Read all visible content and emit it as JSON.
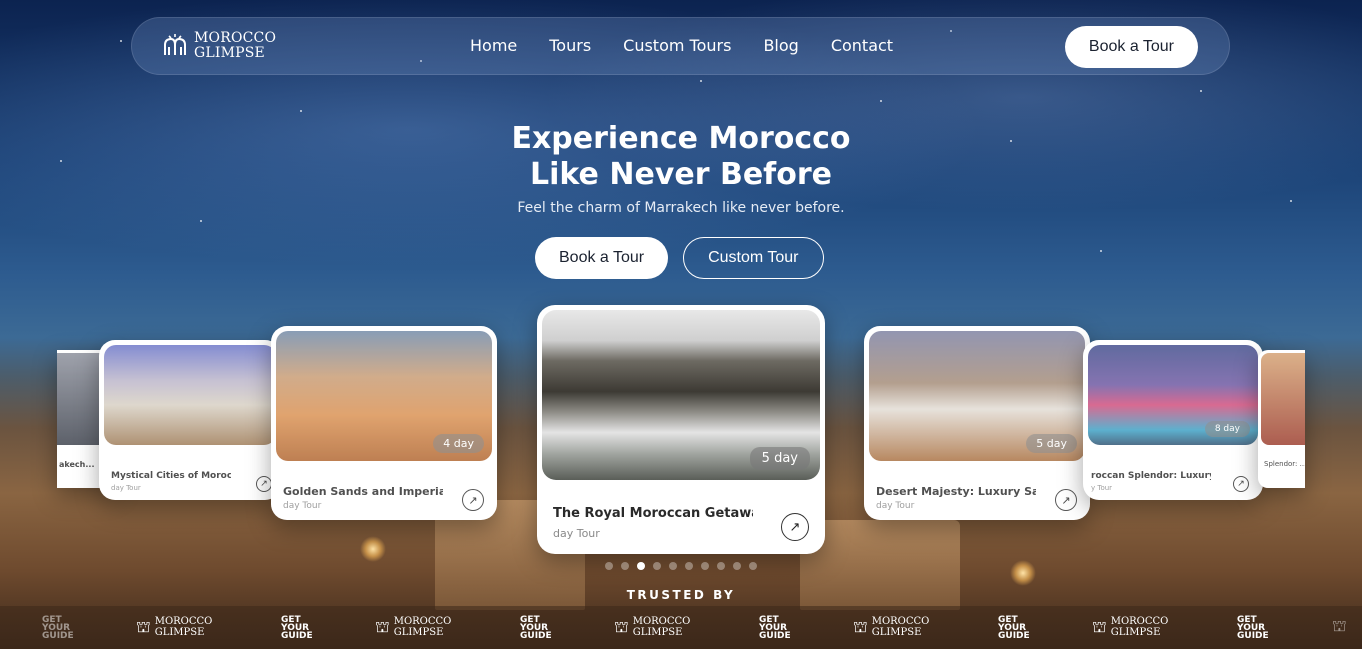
{
  "brand": {
    "line1": "MOROCCO",
    "line2": "GLIMPSE"
  },
  "nav": {
    "items": [
      "Home",
      "Tours",
      "Custom Tours",
      "Blog",
      "Contact"
    ],
    "cta": "Book a Tour"
  },
  "hero": {
    "title_line1": "Experience Morocco",
    "title_line2": "Like Never Before",
    "subtitle": "Feel the charm of Marrakech like never before.",
    "primary_cta": "Book a Tour",
    "secondary_cta": "Custom Tour"
  },
  "cards": {
    "far_left": {
      "title": "akech..."
    },
    "left2": {
      "title": "Mystical Cities of Morocc...",
      "sub": "day Tour"
    },
    "left1": {
      "title": "Golden Sands and Imperial...",
      "sub": "day Tour",
      "badge": "4 day"
    },
    "center": {
      "title": "The Royal Moroccan Getawa...",
      "sub": "day Tour",
      "badge": "5 day"
    },
    "right1": {
      "title": "Desert Majesty: Luxury Sa...",
      "sub": "day Tour",
      "badge": "5 day"
    },
    "right2": {
      "title": "roccan Splendor: Luxury...",
      "sub": "y Tour",
      "badge": "8 day"
    },
    "far_right": {
      "title": "Splendor: ..."
    }
  },
  "carousel": {
    "active_index": 2,
    "total": 10
  },
  "trusted": {
    "label": "TRUSTED BY",
    "gyg_line1": "GET",
    "gyg_line2": "YOUR",
    "gyg_line3": "GUIDE"
  },
  "colors": {
    "cta_bg": "#ffffff",
    "cta_text": "#1b2230",
    "nav_glass": "rgba(120,150,200,0.28)"
  }
}
